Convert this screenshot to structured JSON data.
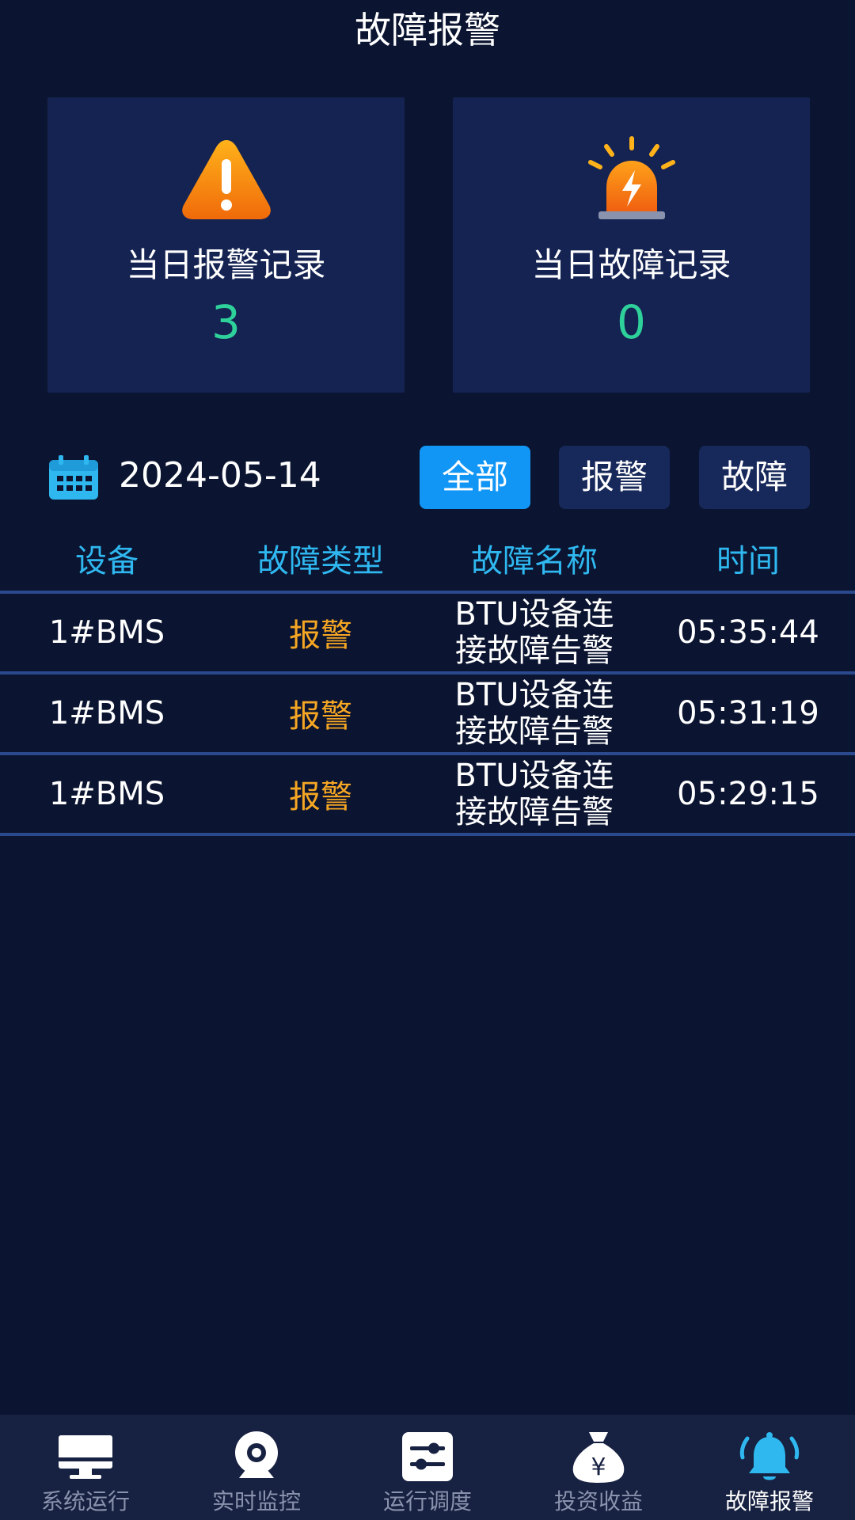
{
  "header": {
    "title": "故障报警"
  },
  "summary": {
    "alarm": {
      "label": "当日报警记录",
      "count": "3"
    },
    "fault": {
      "label": "当日故障记录",
      "count": "0"
    }
  },
  "date": "2024-05-14",
  "filters": {
    "all": "全部",
    "alarm": "报警",
    "fault": "故障",
    "active": "all"
  },
  "table": {
    "headers": [
      "设备",
      "故障类型",
      "故障名称",
      "时间"
    ],
    "rows": [
      {
        "device": "1#BMS",
        "type": "报警",
        "name": "BTU设备连接故障告警",
        "time": "05:35:44"
      },
      {
        "device": "1#BMS",
        "type": "报警",
        "name": "BTU设备连接故障告警",
        "time": "05:31:19"
      },
      {
        "device": "1#BMS",
        "type": "报警",
        "name": "BTU设备连接故障告警",
        "time": "05:29:15"
      }
    ]
  },
  "tabs": [
    {
      "label": "系统运行",
      "icon": "monitor-icon"
    },
    {
      "label": "实时监控",
      "icon": "camera-icon"
    },
    {
      "label": "运行调度",
      "icon": "sliders-icon"
    },
    {
      "label": "投资收益",
      "icon": "money-bag-icon"
    },
    {
      "label": "故障报警",
      "icon": "bell-icon",
      "active": true
    }
  ],
  "colors": {
    "background": "#0b1430",
    "card": "#142352",
    "accent": "#1296f5",
    "count": "#2fd19b",
    "alarm_type": "#f5a623",
    "header_text": "#2fb8f0"
  }
}
